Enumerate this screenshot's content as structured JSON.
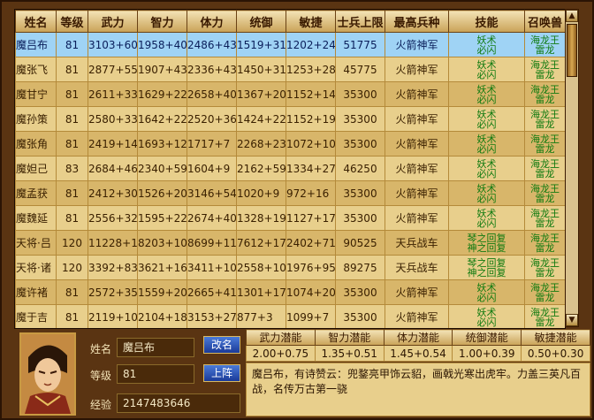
{
  "table": {
    "headers": [
      "姓名",
      "等级",
      "武力",
      "智力",
      "体力",
      "统御",
      "敏捷",
      "士兵上限",
      "最高兵种",
      "技能",
      "召唤兽"
    ],
    "rows": [
      {
        "name": "魔吕布",
        "level": "81",
        "wu": "3103+60",
        "zhi": "1958+40",
        "ti": "2486+43",
        "tong": "1519+31",
        "min": "1202+24",
        "soldiers": "51775",
        "unit": "火箭神军",
        "skill": [
          "妖术",
          "必闪"
        ],
        "summon": [
          "海龙王",
          "雷龙"
        ]
      },
      {
        "name": "魔张飞",
        "level": "81",
        "wu": "2877+55",
        "zhi": "1907+43",
        "ti": "2336+43",
        "tong": "1450+31",
        "min": "1253+28",
        "soldiers": "45775",
        "unit": "火箭神军",
        "skill": [
          "妖术",
          "必闪"
        ],
        "summon": [
          "海龙王",
          "雷龙"
        ]
      },
      {
        "name": "魔甘宁",
        "level": "81",
        "wu": "2611+33",
        "zhi": "1629+22",
        "ti": "2658+40",
        "tong": "1367+20",
        "min": "1152+14",
        "soldiers": "35300",
        "unit": "火箭神军",
        "skill": [
          "妖术",
          "必闪"
        ],
        "summon": [
          "海龙王",
          "雷龙"
        ]
      },
      {
        "name": "魔孙策",
        "level": "81",
        "wu": "2580+33",
        "zhi": "1642+22",
        "ti": "2520+36",
        "tong": "1424+22",
        "min": "1152+19",
        "soldiers": "35300",
        "unit": "火箭神军",
        "skill": [
          "妖术",
          "必闪"
        ],
        "summon": [
          "海龙王",
          "雷龙"
        ]
      },
      {
        "name": "魔张角",
        "level": "81",
        "wu": "2419+14",
        "zhi": "1693+12",
        "ti": "1717+7",
        "tong": "2268+23",
        "min": "1072+10",
        "soldiers": "35300",
        "unit": "火箭神军",
        "skill": [
          "妖术",
          "必闪"
        ],
        "summon": [
          "海龙王",
          "雷龙"
        ]
      },
      {
        "name": "魔妲己",
        "level": "83",
        "wu": "2684+46",
        "zhi": "2340+59",
        "ti": "1604+9",
        "tong": "2162+59",
        "min": "1334+27",
        "soldiers": "46250",
        "unit": "火箭神军",
        "skill": [
          "妖术",
          "必闪"
        ],
        "summon": [
          "海龙王",
          "雷龙"
        ]
      },
      {
        "name": "魔孟获",
        "level": "81",
        "wu": "2412+30",
        "zhi": "1526+20",
        "ti": "3146+54",
        "tong": "1020+9",
        "min": "972+16",
        "soldiers": "35300",
        "unit": "火箭神军",
        "skill": [
          "妖术",
          "必闪"
        ],
        "summon": [
          "海龙王",
          "雷龙"
        ]
      },
      {
        "name": "魔魏延",
        "level": "81",
        "wu": "2556+32",
        "zhi": "1595+22",
        "ti": "2674+40",
        "tong": "1328+19",
        "min": "1127+17",
        "soldiers": "35300",
        "unit": "火箭神军",
        "skill": [
          "妖术",
          "必闪"
        ],
        "summon": [
          "海龙王",
          "雷龙"
        ]
      },
      {
        "name": "天将·吕",
        "level": "120",
        "wu": "11228+1",
        "zhi": "8203+10",
        "ti": "8699+11",
        "tong": "7612+17",
        "min": "2402+71",
        "soldiers": "90525",
        "unit": "天兵战车",
        "skill": [
          "琴之回复",
          "神之回复"
        ],
        "summon": [
          "海龙王",
          "雷龙"
        ]
      },
      {
        "name": "天将·诸",
        "level": "120",
        "wu": "3392+83",
        "zhi": "3621+16",
        "ti": "3411+10",
        "tong": "2558+10",
        "min": "1976+95",
        "soldiers": "89275",
        "unit": "天兵战车",
        "skill": [
          "琴之回复",
          "神之回复"
        ],
        "summon": [
          "海龙王",
          "雷龙"
        ]
      },
      {
        "name": "魔许褚",
        "level": "81",
        "wu": "2572+35",
        "zhi": "1559+20",
        "ti": "2665+41",
        "tong": "1301+17",
        "min": "1074+20",
        "soldiers": "35300",
        "unit": "火箭神军",
        "skill": [
          "妖术",
          "必闪"
        ],
        "summon": [
          "海龙王",
          "雷龙"
        ]
      },
      {
        "name": "魔于吉",
        "level": "81",
        "wu": "2119+10",
        "zhi": "2104+18",
        "ti": "3153+27",
        "tong": "877+3",
        "min": "1099+7",
        "soldiers": "35300",
        "unit": "火箭神军",
        "skill": [
          "妖术",
          "必闪"
        ],
        "summon": [
          "海龙王",
          "雷龙"
        ]
      }
    ]
  },
  "detail": {
    "name_label": "姓名",
    "name_value": "魔吕布",
    "level_label": "等级",
    "level_value": "81",
    "exp_label": "经验",
    "exp_value": "2147483646",
    "rename_button": "改名",
    "deploy_button": "上阵",
    "potential_headers": [
      "武力潜能",
      "智力潜能",
      "体力潜能",
      "统御潜能",
      "敏捷潜能"
    ],
    "potential_values": [
      "2.00+0.75",
      "1.35+0.51",
      "1.45+0.54",
      "1.00+0.39",
      "0.50+0.30"
    ],
    "description": "魔吕布，有诗赞云：兜鍪亮甲饰云貂，画戟光寒出虎牢。力盖三英凡百战，名传万古第一骁"
  }
}
